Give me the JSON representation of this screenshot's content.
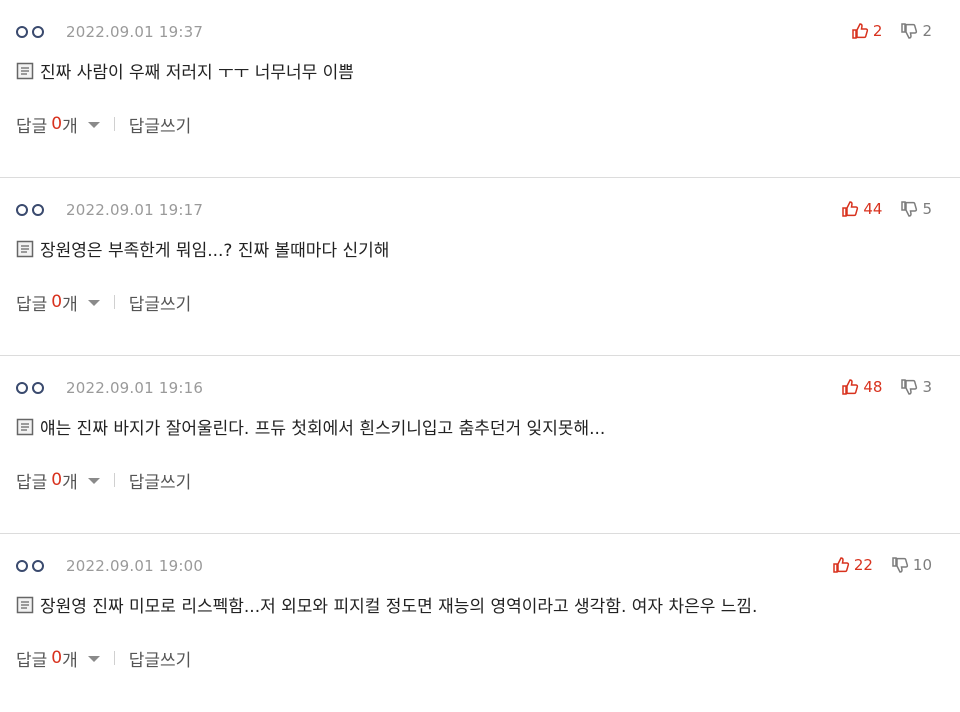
{
  "colors": {
    "accent": "#d8321e",
    "muted": "#9a9a9a",
    "divider": "#dcdcdc",
    "user_icon": "#3a4a6e"
  },
  "icons": {
    "user": "double-ring-icon",
    "up": "thumbs-up-icon",
    "down": "thumbs-down-icon",
    "doc": "document-icon",
    "caret": "chevron-down-icon"
  },
  "comments": [
    {
      "timestamp": "2022.09.01 19:37",
      "likes": "2",
      "dislikes": "2",
      "text": "진짜 사람이 우째 저러지 ㅜㅜ 너무너무 이쁨",
      "reply_label": "답글",
      "reply_count": "0",
      "reply_unit": "개",
      "write_label": "답글쓰기"
    },
    {
      "timestamp": "2022.09.01 19:17",
      "likes": "44",
      "dislikes": "5",
      "text": "장원영은 부족한게 뭐임...? 진짜 볼때마다 신기해",
      "reply_label": "답글",
      "reply_count": "0",
      "reply_unit": "개",
      "write_label": "답글쓰기"
    },
    {
      "timestamp": "2022.09.01 19:16",
      "likes": "48",
      "dislikes": "3",
      "text": "얘는 진짜 바지가 잘어울린다. 프듀 첫회에서 흰스키니입고 춤추던거 잊지못해...",
      "reply_label": "답글",
      "reply_count": "0",
      "reply_unit": "개",
      "write_label": "답글쓰기"
    },
    {
      "timestamp": "2022.09.01 19:00",
      "likes": "22",
      "dislikes": "10",
      "text": "장원영 진짜 미모로 리스펙함...저 외모와 피지컬 정도면 재능의 영역이라고 생각함. 여자 차은우 느낌.",
      "reply_label": "답글",
      "reply_count": "0",
      "reply_unit": "개",
      "write_label": "답글쓰기"
    }
  ]
}
